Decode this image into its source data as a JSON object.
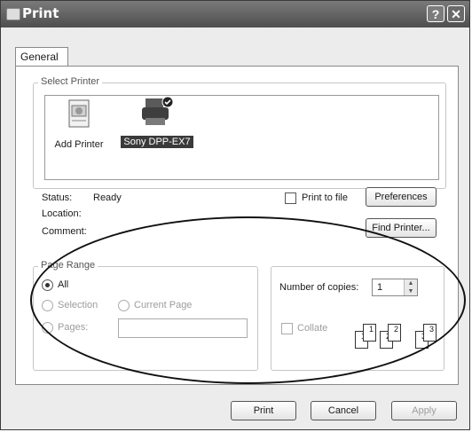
{
  "window": {
    "title": "Print",
    "help_glyph": "?",
    "close_glyph": "✕"
  },
  "tabs": [
    {
      "label": "General"
    }
  ],
  "select_printer": {
    "legend": "Select Printer",
    "printers": [
      {
        "label": "Add Printer",
        "icon": "add-printer-icon"
      },
      {
        "label": "Sony DPP-EX7",
        "icon": "printer-icon"
      }
    ]
  },
  "status": {
    "status_label": "Status:",
    "status_value": "Ready",
    "location_label": "Location:",
    "location_value": "",
    "comment_label": "Comment:",
    "comment_value": ""
  },
  "print_to_file": {
    "label": "Print to file",
    "checked": false
  },
  "buttons": {
    "preferences": "Preferences",
    "find_printer": "Find Printer...",
    "print": "Print",
    "cancel": "Cancel",
    "apply": "Apply"
  },
  "page_range": {
    "legend": "Page Range",
    "all": "All",
    "selection": "Selection",
    "current_page": "Current Page",
    "pages": "Pages:",
    "pages_value": ""
  },
  "copies": {
    "label": "Number of copies:",
    "value": "1",
    "collate_label": "Collate",
    "collate_checked": false,
    "page_numbers": [
      "1",
      "1",
      "2",
      "2",
      "3",
      "3"
    ]
  },
  "colors": {
    "titlebar": "#5c5c5c",
    "panel": "#ffffff",
    "selected_item_bg": "#3a3a3a"
  }
}
